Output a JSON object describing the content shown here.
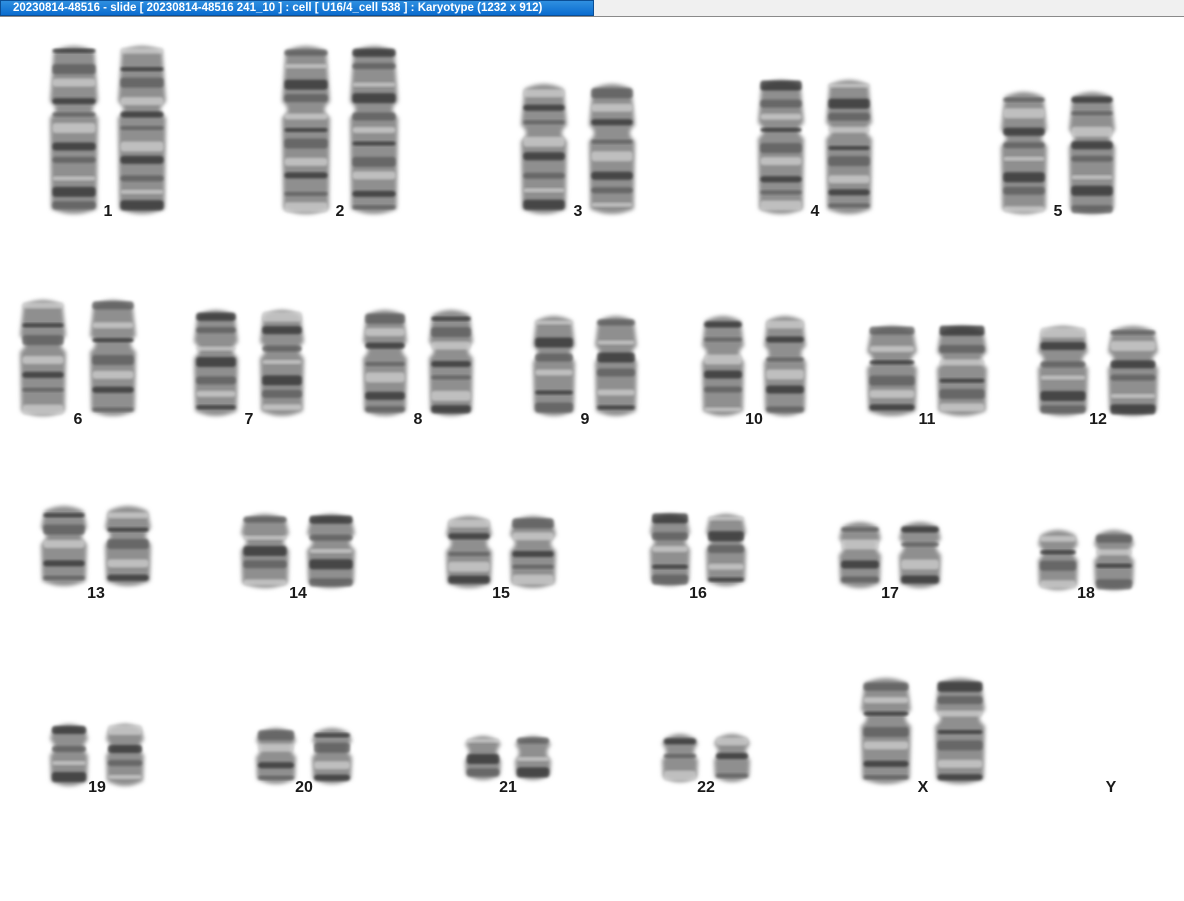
{
  "window": {
    "title": "20230814-48516 - slide [ 20230814-48516 241_10 ] : cell [ U16/4_cell 538 ] : Karyotype  (1232 x 912)"
  },
  "karyotype": {
    "chromosomes": [
      {
        "label": "1",
        "count": 2
      },
      {
        "label": "2",
        "count": 2
      },
      {
        "label": "3",
        "count": 2
      },
      {
        "label": "4",
        "count": 2
      },
      {
        "label": "5",
        "count": 2
      },
      {
        "label": "6",
        "count": 2
      },
      {
        "label": "7",
        "count": 2
      },
      {
        "label": "8",
        "count": 2
      },
      {
        "label": "9",
        "count": 2
      },
      {
        "label": "10",
        "count": 2
      },
      {
        "label": "11",
        "count": 2
      },
      {
        "label": "12",
        "count": 2
      },
      {
        "label": "13",
        "count": 2
      },
      {
        "label": "14",
        "count": 2
      },
      {
        "label": "15",
        "count": 2
      },
      {
        "label": "16",
        "count": 2
      },
      {
        "label": "17",
        "count": 2
      },
      {
        "label": "18",
        "count": 2
      },
      {
        "label": "19",
        "count": 2
      },
      {
        "label": "20",
        "count": 2
      },
      {
        "label": "21",
        "count": 2
      },
      {
        "label": "22",
        "count": 2
      },
      {
        "label": "X",
        "count": 2
      },
      {
        "label": "Y",
        "count": 0
      }
    ]
  }
}
